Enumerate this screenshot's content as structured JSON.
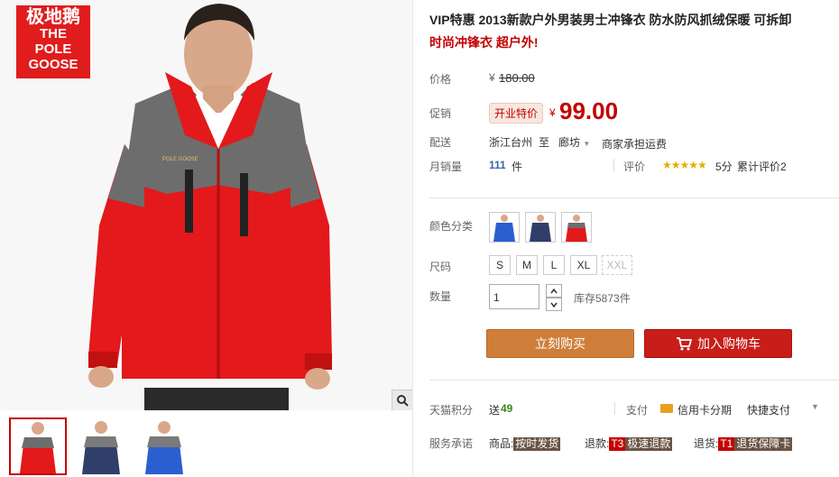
{
  "gallery": {
    "logo_cn": "极地鹅",
    "logo_en": [
      "THE",
      "POLE",
      "GOOSE"
    ],
    "jacket_logo": "POLE GOOSE"
  },
  "product": {
    "title_part1": "VIP特惠 2013新款户外男装男士冲锋衣 防水防风抓绒保暖 可拆卸",
    "title_part2": "时尚冲锋衣 超户外!"
  },
  "price": {
    "label": "价格",
    "currency": "¥",
    "original": "180.00"
  },
  "promo": {
    "label": "促销",
    "tag": "开业特价",
    "currency": "¥",
    "price": "99.00"
  },
  "delivery": {
    "label": "配送",
    "from": "浙江台州",
    "to_word": "至",
    "destination": "廊坊",
    "shipping": "商家承担运费"
  },
  "sales": {
    "label": "月销量",
    "count": "111",
    "unit": "件",
    "review_label": "评价",
    "stars": "★★★★★",
    "score": "5分",
    "reviews_text": "累计评价2"
  },
  "color": {
    "label": "颜色分类",
    "options": [
      "blue",
      "navy",
      "red"
    ]
  },
  "size": {
    "label": "尺码",
    "options": [
      "S",
      "M",
      "L",
      "XL",
      "XXL"
    ]
  },
  "quantity": {
    "label": "数量",
    "value": "1",
    "stock": "库存5873件"
  },
  "actions": {
    "buy_now": "立刻购买",
    "add_to_cart": "加入购物车"
  },
  "points": {
    "label": "天猫积分",
    "send": "送",
    "value": "49"
  },
  "payment": {
    "label": "支付",
    "credit": "信用卡分期",
    "fast": "快捷支付"
  },
  "service": {
    "label": "服务承诺",
    "items": [
      {
        "prefix": "商品:",
        "badge": "",
        "text": "按时发货"
      },
      {
        "prefix": "退款:",
        "badge": "T3",
        "text": "极速退款"
      },
      {
        "prefix": "退货:",
        "badge": "T1",
        "text": "退货保障卡"
      }
    ]
  },
  "colors": {
    "accent_red": "#c40000",
    "buy_button": "#cf7e3a",
    "cart_button": "#c91d19",
    "jacket_red": "#e3191c",
    "jacket_gray": "#6d6d6d"
  }
}
